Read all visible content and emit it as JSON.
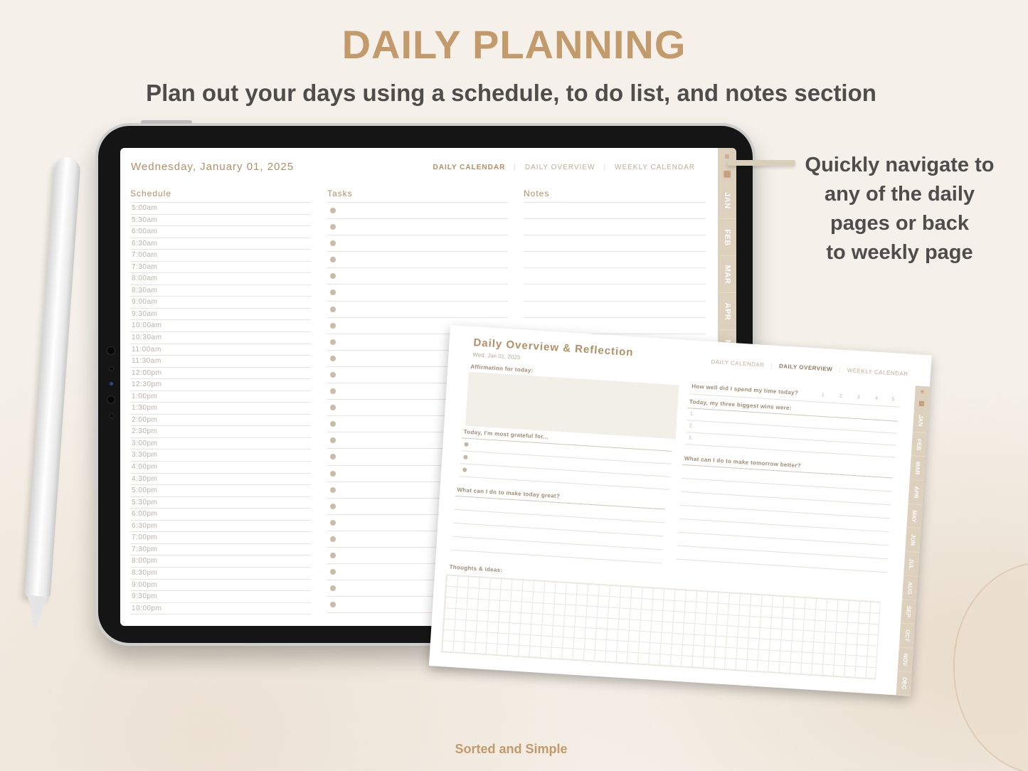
{
  "marketing": {
    "headline": "DAILY PLANNING",
    "subheadline": "Plan out your days using a schedule, to do list, and notes section",
    "callout_lines": [
      "Quickly navigate to",
      "any of the daily",
      "pages or back",
      "to weekly page"
    ],
    "footer": "Sorted and Simple"
  },
  "daily_page": {
    "date": "Wednesday, January 01, 2025",
    "nav": [
      {
        "label": "DAILY CALENDAR",
        "active": true
      },
      {
        "label": "DAILY OVERVIEW",
        "active": false
      },
      {
        "label": "WEEKLY CALENDAR",
        "active": false
      }
    ],
    "nav_separator": "|",
    "schedule_heading": "Schedule",
    "tasks_heading": "Tasks",
    "notes_heading": "Notes",
    "schedule_times": [
      "5:00am",
      "5:30am",
      "6:00am",
      "6:30am",
      "7:00am",
      "7:30am",
      "8:00am",
      "8:30am",
      "9:00am",
      "9:30am",
      "10:00am",
      "10:30am",
      "11:00am",
      "11:30am",
      "12:00pm",
      "12:30pm",
      "1:00pm",
      "1:30pm",
      "2:00pm",
      "2:30pm",
      "3:00pm",
      "3:30pm",
      "4:00pm",
      "4:30pm",
      "5:00pm",
      "5:30pm",
      "6:00pm",
      "6:30pm",
      "7:00pm",
      "7:30pm",
      "8:00pm",
      "8:30pm",
      "9:00pm",
      "9:30pm",
      "10:00pm"
    ],
    "task_row_count": 25,
    "note_row_count": 25
  },
  "side_tabs": {
    "menu_icon": "≡",
    "calendar_icon": "▦",
    "months": [
      "JAN",
      "FEB",
      "MAR",
      "APR",
      "MAY",
      "JUN",
      "JUL",
      "AUG",
      "SEP",
      "OCT",
      "NOV",
      "DEC"
    ]
  },
  "overview_page": {
    "title": "Daily Overview & Reflection",
    "date": "Wed, Jan 01, 2025",
    "nav": [
      {
        "label": "DAILY CALENDAR",
        "active": false
      },
      {
        "label": "DAILY OVERVIEW",
        "active": true
      },
      {
        "label": "WEEKLY CALENDAR",
        "active": false
      }
    ],
    "affirmation_label": "Affirmation for today:",
    "grateful_label": "Today, I'm most grateful for...",
    "today_great_label": "What can I do to make today great?",
    "thoughts_label": "Thoughts & ideas:",
    "time_rating_label": "How well did I spend my time today?",
    "rating_scale": [
      "1",
      "2",
      "3",
      "4",
      "5"
    ],
    "wins_label": "Today, my three biggest wins were:",
    "wins_numbers": [
      "1.",
      "2.",
      "3."
    ],
    "tomorrow_label": "What can I do to make tomorrow better?"
  },
  "colors": {
    "accent": "#c39a6b",
    "tab_bar": "#ddd0bd",
    "text_dark": "#4f4d4c"
  }
}
